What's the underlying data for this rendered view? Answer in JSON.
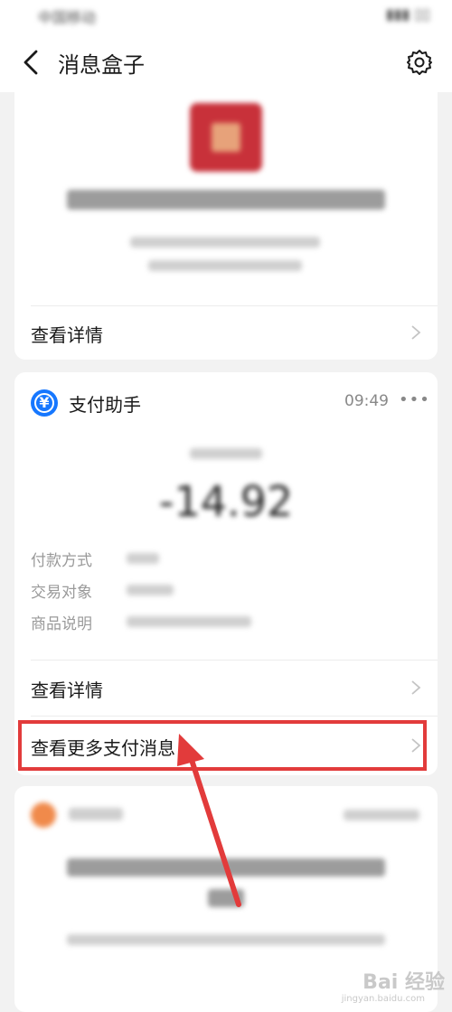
{
  "status_bar": {
    "left": "中国移动",
    "right": ""
  },
  "nav": {
    "title": "消息盒子"
  },
  "card1": {
    "view_details": "查看详情"
  },
  "card2": {
    "title": "支付助手",
    "time": "09:49",
    "amount": "-14.92",
    "labels": [
      "付款方式",
      "交易对象",
      "商品说明"
    ],
    "view_details": "查看详情",
    "view_more": "查看更多支付消息"
  },
  "watermark": {
    "text": "Bai 经验",
    "sub": "jingyan.baidu.com"
  },
  "colors": {
    "accent_red": "#e23b3b",
    "pay_blue": "#1677ff"
  }
}
